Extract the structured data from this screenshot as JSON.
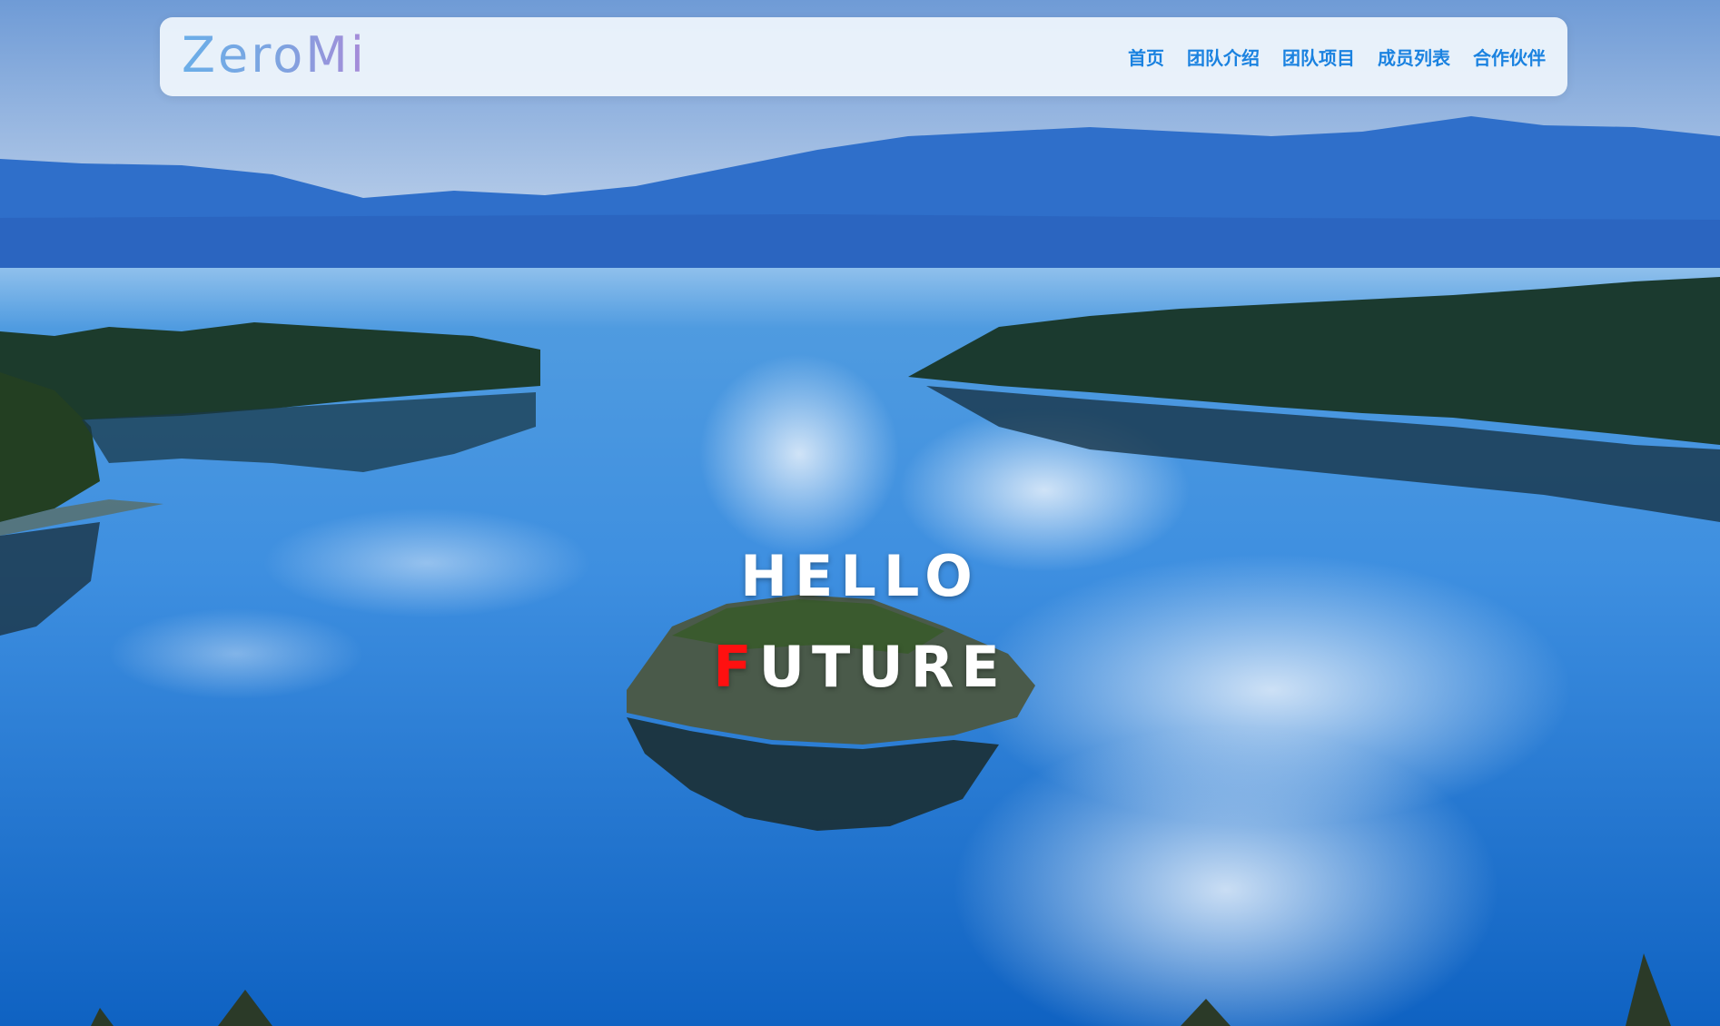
{
  "header": {
    "logo": "ZeroMi",
    "nav": [
      {
        "label": "首页"
      },
      {
        "label": "团队介绍"
      },
      {
        "label": "团队项目"
      },
      {
        "label": "成员列表"
      },
      {
        "label": "合作伙伴"
      }
    ]
  },
  "hero": {
    "line1": "HELLO",
    "line2_first_letter": "F",
    "line2_rest": "UTURE",
    "accent_color": "#ff1010",
    "background": "lake with forested shores, distant blue mountains and a small island"
  },
  "colors": {
    "nav_link": "#1a82e0",
    "sky": "#6f9fd8",
    "water": "#1f78d4"
  }
}
